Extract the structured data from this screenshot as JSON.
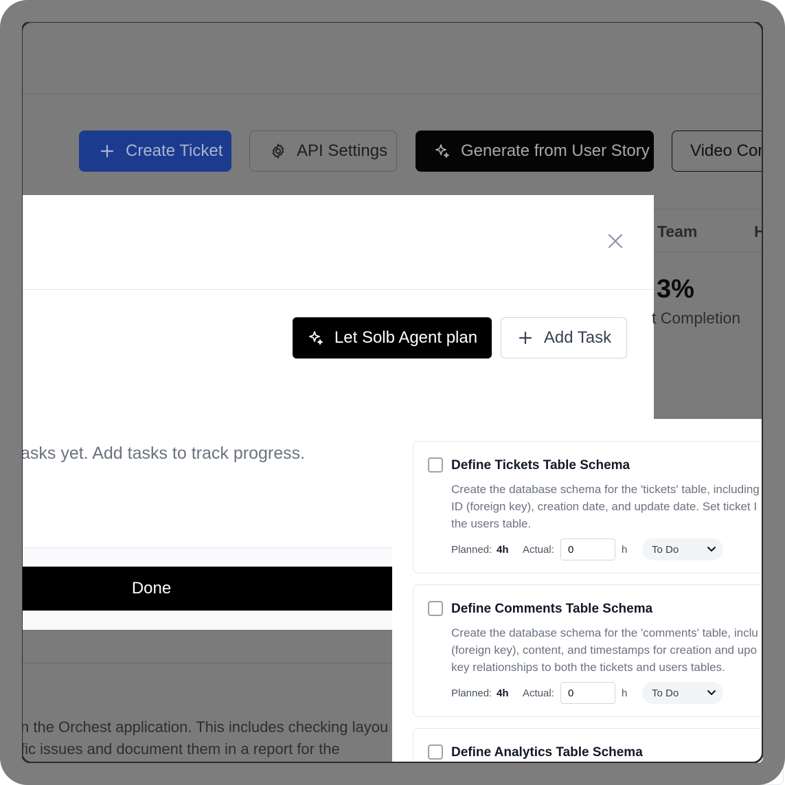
{
  "toolbar": {
    "create_ticket_label": "Create Ticket",
    "api_settings_label": "API Settings",
    "generate_label": "Generate from User Story",
    "video_label": "Video Con"
  },
  "background": {
    "team_header": "Team",
    "next_col_header": "H",
    "percent_value": "3%",
    "percent_caption": "t Completion",
    "desc_line1": "n the Orchest application. This includes checking layou",
    "desc_line2": "fic issues and document them in a report for the"
  },
  "modal": {
    "close_icon": "close-icon",
    "agent_plan_label": "Let Solb Agent plan",
    "add_task_label": "Add Task",
    "empty_text": "asks yet. Add tasks to track progress.",
    "done_label": "Done"
  },
  "tasks": [
    {
      "title": "Define Tickets Table Schema",
      "desc": [
        "Create the database schema for the 'tickets' table, including",
        "ID (foreign key), creation date, and update date. Set ticket I",
        "the users table."
      ],
      "planned_label": "Planned:",
      "planned_value": "4h",
      "actual_label": "Actual:",
      "actual_value": "0",
      "unit": "h",
      "status": "To Do"
    },
    {
      "title": "Define Comments Table Schema",
      "desc": [
        "Create the database schema for the 'comments' table, inclu",
        "(foreign key), content, and timestamps for creation and upo",
        "key relationships to both the tickets and users tables."
      ],
      "planned_label": "Planned:",
      "planned_value": "4h",
      "actual_label": "Actual:",
      "actual_value": "0",
      "unit": "h",
      "status": "To Do"
    },
    {
      "title": "Define Analytics Table Schema"
    }
  ],
  "colors": {
    "primary": "#1d4ed8",
    "dark": "#000000",
    "overlay": "#7b7b7b"
  }
}
